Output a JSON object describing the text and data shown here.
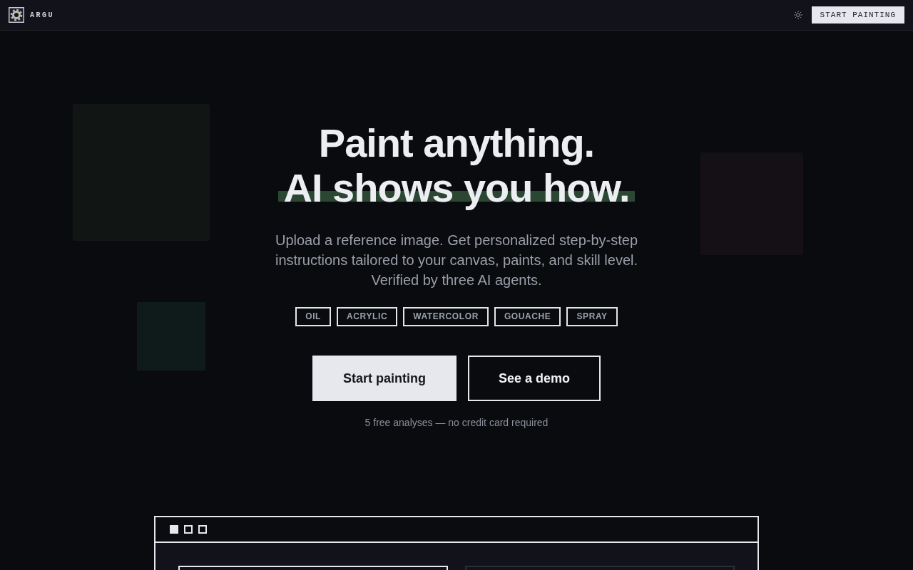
{
  "header": {
    "brand": "ARGU",
    "button": "START PAINTING"
  },
  "hero": {
    "title_lines": [
      {
        "text": "Paint anything.",
        "highlighted": false
      },
      {
        "text": "AI shows you how.",
        "highlighted": true
      }
    ],
    "description_lines": [
      "Upload a reference image. Get personalized step-by-step",
      "instructions tailored to your canvas, paints, and skill level.",
      "Verified by three AI agents."
    ],
    "tags": [
      "OIL",
      "ACRYLIC",
      "WATERCOLOR",
      "GOUACHE",
      "SPRAY"
    ],
    "buttons": [
      {
        "label": "Start painting",
        "kind": "primary"
      },
      {
        "label": "See a demo",
        "kind": "secondary"
      }
    ],
    "note": "5 free analyses — no credit card required"
  }
}
